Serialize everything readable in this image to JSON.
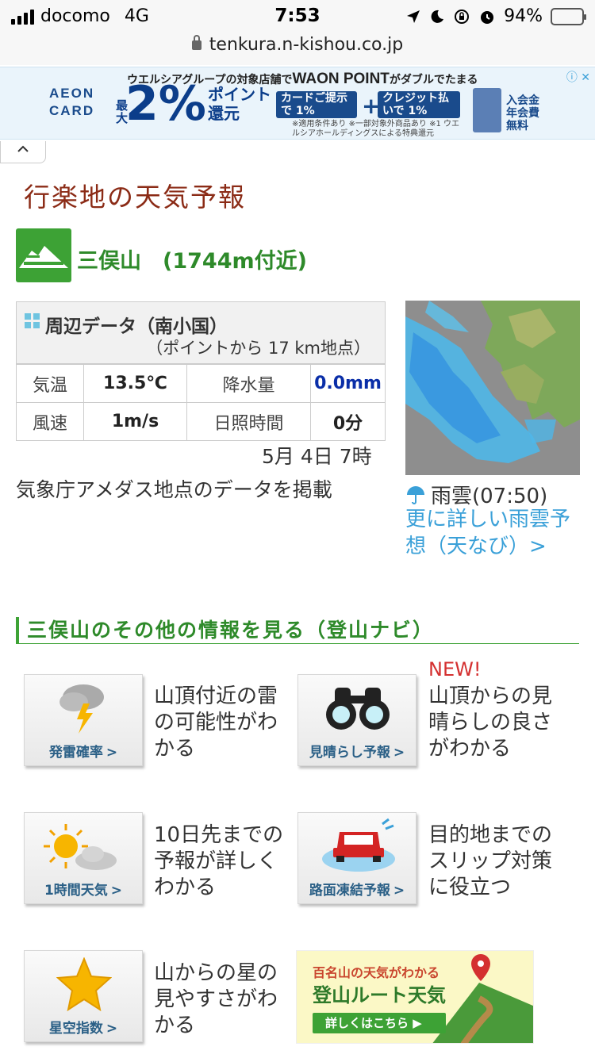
{
  "status_bar": {
    "carrier": "docomo",
    "network": "4G",
    "time": "7:53",
    "battery": "94%"
  },
  "browser": {
    "url": "tenkura.n-kishou.co.jp"
  },
  "ad": {
    "brand": "AEON CARD",
    "headline": "ウエルシアグループの対象店舗で",
    "waon": "WAON POINT",
    "headline_tail": "がダブルでたまる",
    "percent": "2%",
    "point_label": "ポイント還元",
    "max_label": "最大",
    "card_box": "カードご提示で 1%",
    "credit_box": "クレジット払いで 1%",
    "plus": "+",
    "notes": "※適用条件あり ※一部対象外商品あり ※1 ウエルシアホールディングスによる特典還元",
    "free_label": "入会金 年会費 無料",
    "info": "ⓘ ✕"
  },
  "page": {
    "title": "行楽地の天気予報",
    "mountain": "三俣山　(1744m付近)",
    "data_header": "周辺データ（南小国）",
    "data_sub": "（ポイントから 17 km地点）",
    "rows": [
      {
        "l1": "気温",
        "v1": "13.5℃",
        "l2": "降水量",
        "v2": "0.0mm"
      },
      {
        "l1": "風速",
        "v1": "1m/s",
        "l2": "日照時間",
        "v2": "0分"
      }
    ],
    "date": "5月 4日 7時",
    "amedas_note": "気象庁アメダス地点のデータを掲載",
    "radar_caption": "雨雲(07:50)",
    "radar_link": "更に詳しい雨雲予想（天なび）>",
    "section_title": "三俣山のその他の情報を見る（登山ナビ）",
    "new_badge": "NEW!"
  },
  "cards": [
    {
      "label": "発雷確率",
      "desc": "山頂付近の雷の可能性がわかる"
    },
    {
      "label": "見晴らし予報",
      "desc": "山頂からの見晴らしの良さがわかる"
    },
    {
      "label": "1時間天気",
      "desc": "10日先までの予報が詳しくわかる"
    },
    {
      "label": "路面凍結予報",
      "desc": "目的地までのスリップ対策に役立つ"
    },
    {
      "label": "星空指数",
      "desc": "山からの星の見やすさがわかる"
    }
  ],
  "banner": {
    "line1": "百名山の天気がわかる",
    "line2": "登山ルート天気",
    "button": "詳しくはこちら ▶"
  },
  "chevron": ">"
}
